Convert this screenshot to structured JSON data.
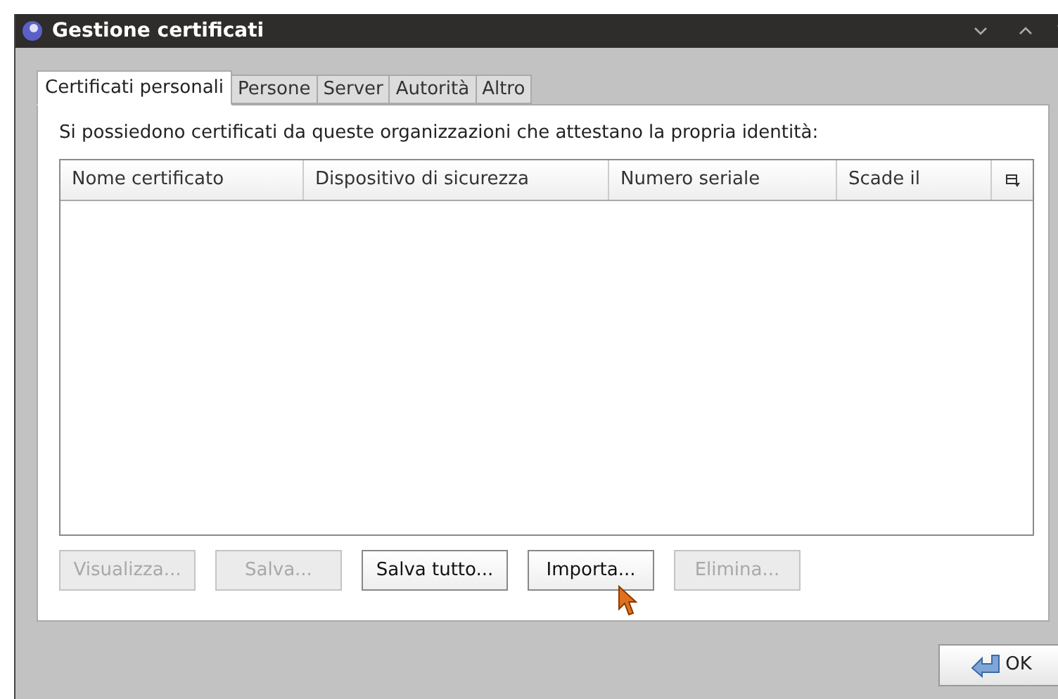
{
  "window": {
    "title": "Gestione certificati"
  },
  "tabs": [
    {
      "label": "Certificati personali",
      "selected": true
    },
    {
      "label": "Persone",
      "selected": false
    },
    {
      "label": "Server",
      "selected": false
    },
    {
      "label": "Autorità",
      "selected": false
    },
    {
      "label": "Altro",
      "selected": false
    }
  ],
  "description": "Si possiedono certificati da queste organizzazioni che attestano la propria identità:",
  "table": {
    "columns": [
      "Nome certificato",
      "Dispositivo di sicurezza",
      "Numero seriale",
      "Scade il"
    ]
  },
  "buttons": [
    {
      "label": "Visualizza...",
      "disabled": true
    },
    {
      "label": "Salva...",
      "disabled": true
    },
    {
      "label": "Salva tutto...",
      "disabled": false
    },
    {
      "label": "Importa...",
      "disabled": false
    },
    {
      "label": "Elimina...",
      "disabled": true
    }
  ],
  "ok_button": {
    "label": "OK"
  }
}
